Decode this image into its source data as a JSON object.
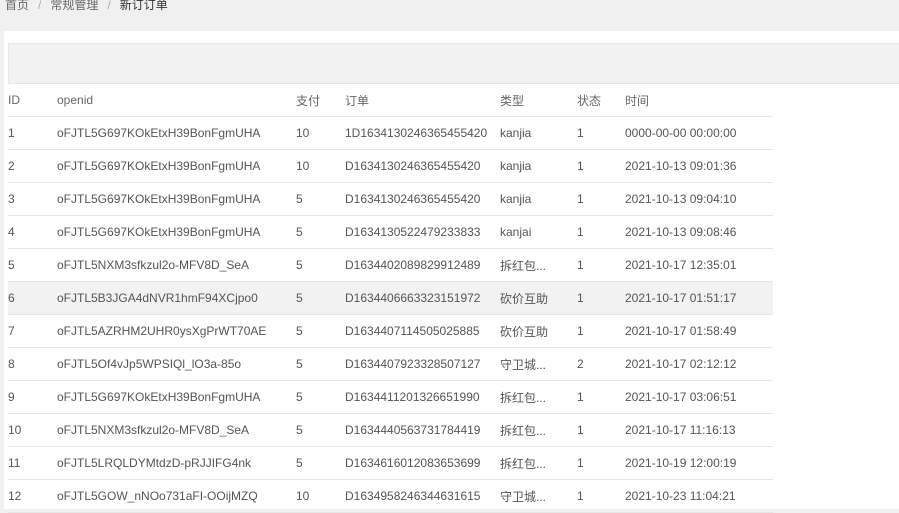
{
  "breadcrumb": {
    "home": "首页",
    "section": "常规管理",
    "current": "新订订单"
  },
  "table": {
    "columns": [
      "ID",
      "openid",
      "支付",
      "订单",
      "类型",
      "状态",
      "时间"
    ],
    "rows": [
      {
        "id": "1",
        "openid": "oFJTL5G697KOkEtxH39BonFgmUHA",
        "pay": "10",
        "order": "1D1634130246365455420",
        "type": "kanjia",
        "status": "1",
        "time": "0000-00-00 00:00:00"
      },
      {
        "id": "2",
        "openid": "oFJTL5G697KOkEtxH39BonFgmUHA",
        "pay": "10",
        "order": "D1634130246365455420",
        "type": "kanjia",
        "status": "1",
        "time": "2021-10-13 09:01:36"
      },
      {
        "id": "3",
        "openid": "oFJTL5G697KOkEtxH39BonFgmUHA",
        "pay": "5",
        "order": "D1634130246365455420",
        "type": "kanjia",
        "status": "1",
        "time": "2021-10-13 09:04:10"
      },
      {
        "id": "4",
        "openid": "oFJTL5G697KOkEtxH39BonFgmUHA",
        "pay": "5",
        "order": "D1634130522479233833",
        "type": "kanjai",
        "status": "1",
        "time": "2021-10-13 09:08:46"
      },
      {
        "id": "5",
        "openid": "oFJTL5NXM3sfkzul2o-MFV8D_SeA",
        "pay": "5",
        "order": "D1634402089829912489",
        "type": "拆红包...",
        "status": "1",
        "time": "2021-10-17 12:35:01"
      },
      {
        "id": "6",
        "openid": "oFJTL5B3JGA4dNVR1hmF94XCjpo0",
        "pay": "5",
        "order": "D1634406663323151972",
        "type": "砍价互助",
        "status": "1",
        "time": "2021-10-17 01:51:17"
      },
      {
        "id": "7",
        "openid": "oFJTL5AZRHM2UHR0ysXgPrWT70AE",
        "pay": "5",
        "order": "D1634407114505025885",
        "type": "砍价互助",
        "status": "1",
        "time": "2021-10-17 01:58:49"
      },
      {
        "id": "8",
        "openid": "oFJTL5Of4vJp5WPSIQl_lO3a-85o",
        "pay": "5",
        "order": "D1634407923328507127",
        "type": "守卫城...",
        "status": "2",
        "time": "2021-10-17 02:12:12"
      },
      {
        "id": "9",
        "openid": "oFJTL5G697KOkEtxH39BonFgmUHA",
        "pay": "5",
        "order": "D1634411201326651990",
        "type": "拆红包...",
        "status": "1",
        "time": "2021-10-17 03:06:51"
      },
      {
        "id": "10",
        "openid": "oFJTL5NXM3sfkzul2o-MFV8D_SeA",
        "pay": "5",
        "order": "D1634440563731784419",
        "type": "拆红包...",
        "status": "1",
        "time": "2021-10-17 11:16:13"
      },
      {
        "id": "11",
        "openid": "oFJTL5LRQLDYMtdzD-pRJJIFG4nk",
        "pay": "5",
        "order": "D1634616012083653699",
        "type": "拆红包...",
        "status": "1",
        "time": "2021-10-19 12:00:19"
      },
      {
        "id": "12",
        "openid": "oFJTL5GOW_nNOo731aFI-OOijMZQ",
        "pay": "10",
        "order": "D1634958246344631615",
        "type": "守卫城...",
        "status": "1",
        "time": "2021-10-23 11:04:21"
      }
    ]
  }
}
